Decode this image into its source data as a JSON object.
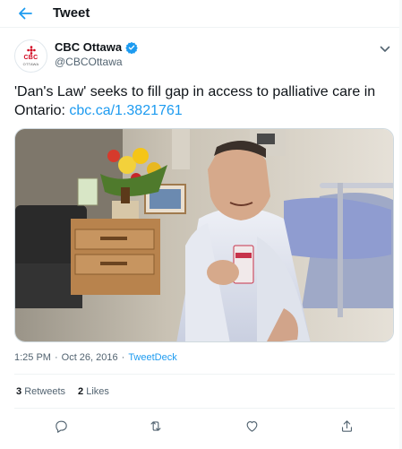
{
  "header": {
    "title": "Tweet"
  },
  "author": {
    "display_name": "CBC Ottawa",
    "handle": "@CBCOttawa",
    "avatar_text": "CBC",
    "avatar_sub": "OTTAWA",
    "verified": true
  },
  "tweet": {
    "text": "'Dan's Law' seeks to fill gap in access to palliative care in Ontario: ",
    "link": "cbc.ca/1.3821761"
  },
  "media": {
    "alt_hint": "photo"
  },
  "meta": {
    "time": "1:25 PM",
    "separator": "·",
    "date": "Oct 26, 2016",
    "separator2": "·",
    "source": "TweetDeck"
  },
  "stats": {
    "retweets_count": "3",
    "retweets_label": "Retweets",
    "likes_count": "2",
    "likes_label": "Likes"
  },
  "actions": {
    "reply_icon": "reply-icon",
    "retweet_icon": "retweet-icon",
    "like_icon": "heart-icon",
    "share_icon": "share-icon"
  },
  "colors": {
    "accent": "#1d9bf0",
    "text": "#0f1419",
    "muted": "#536471",
    "border": "#eff3f4"
  }
}
